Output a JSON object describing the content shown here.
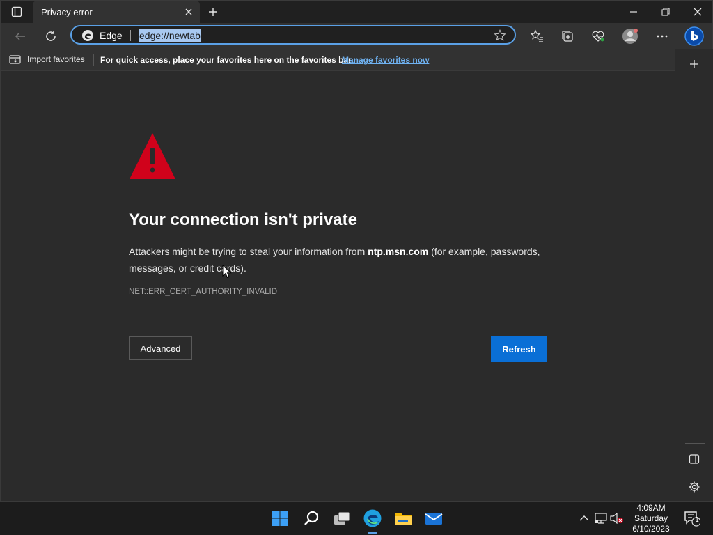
{
  "browser": {
    "tab": {
      "title": "Privacy error"
    },
    "address_bar": {
      "brand": "Edge",
      "url": "edge://newtab"
    }
  },
  "favorites_bar": {
    "import_label": "Import favorites",
    "prompt": "For quick access, place your favorites here on the favorites bar.",
    "manage_link": "Manage favorites now"
  },
  "error_page": {
    "heading": "Your connection isn't private",
    "message_before": "Attackers might be trying to steal your information from ",
    "host": "ntp.msn.com",
    "message_after": " (for example, passwords, messages, or credit cards).",
    "error_code": "NET::ERR_CERT_AUTHORITY_INVALID",
    "advanced_label": "Advanced",
    "refresh_label": "Refresh"
  },
  "taskbar": {
    "time": "4:09AM",
    "day": "Saturday",
    "date": "6/10/2023",
    "notification_count": "1"
  },
  "colors": {
    "accent": "#0a6fd6",
    "warning": "#d0021b",
    "link": "#6fb2f2"
  }
}
